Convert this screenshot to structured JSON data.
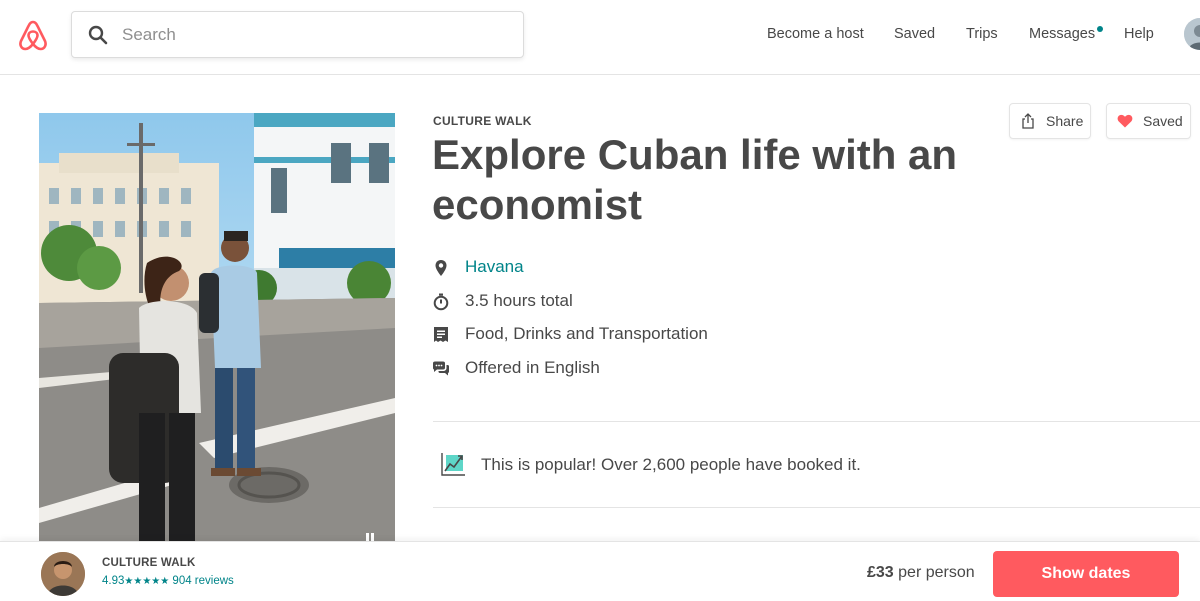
{
  "header": {
    "logo_icon": "airbnb-logo-icon",
    "search": {
      "placeholder": "Search",
      "value": ""
    },
    "nav": [
      {
        "label": "Become a host"
      },
      {
        "label": "Saved"
      },
      {
        "label": "Trips"
      },
      {
        "label": "Messages",
        "has_notification_dot": true
      },
      {
        "label": "Help"
      }
    ]
  },
  "experience": {
    "category": "CULTURE WALK",
    "title": "Explore Cuban life with an economist",
    "actions": {
      "share_label": "Share",
      "saved_label": "Saved"
    },
    "details": [
      {
        "icon": "location-pin-icon",
        "text": "Havana",
        "is_link": true
      },
      {
        "icon": "stopwatch-icon",
        "text": "3.5 hours total"
      },
      {
        "icon": "receipt-icon",
        "text": "Food, Drinks and Transportation"
      },
      {
        "icon": "chat-bubbles-icon",
        "text": "Offered in English"
      }
    ],
    "popular": {
      "icon": "trending-chart-icon",
      "text": "This is popular! Over 2,600 people have booked it."
    }
  },
  "bottom_bar": {
    "category": "CULTURE WALK",
    "rating": "4.93",
    "stars": "★★★★★",
    "reviews": "904 reviews",
    "price": "£33",
    "price_suffix": "per person",
    "cta_label": "Show dates"
  },
  "colors": {
    "brand": "#ff5a5f",
    "link": "#008489",
    "text": "#484848",
    "border": "#e4e4e4"
  }
}
